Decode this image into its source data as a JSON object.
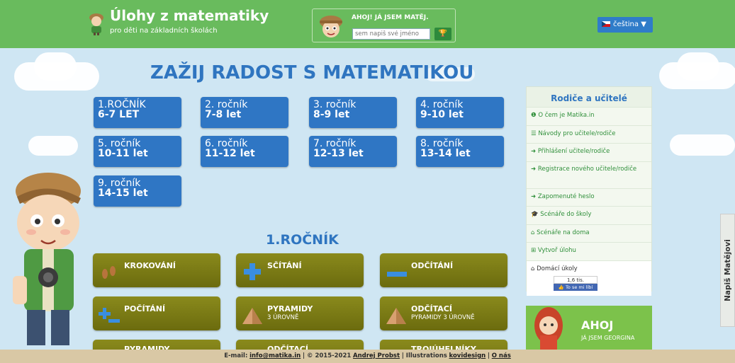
{
  "header": {
    "title": "Úlohy z matematiky",
    "subtitle": "pro děti na základních školách",
    "greeting": "AHOJ! JÁ JSEM MATĚJ.",
    "name_placeholder": "sem napiš své jméno",
    "language": "čeština",
    "colors": {
      "bar": "#69bb5d",
      "language_button": "#2f7cc9"
    }
  },
  "main": {
    "title": "ZAŽIJ RADOST S MATEMATIKOU",
    "grades": [
      {
        "label": "1.ROČNÍK",
        "ages": "6-7 LET"
      },
      {
        "label": "2. ročník",
        "ages": "7-8 let"
      },
      {
        "label": "3. ročník",
        "ages": "8-9 let"
      },
      {
        "label": "4. ročník",
        "ages": "9-10 let"
      },
      {
        "label": "5. ročník",
        "ages": "10-11 let"
      },
      {
        "label": "6. ročník",
        "ages": "11-12 let"
      },
      {
        "label": "7. ročník",
        "ages": "12-13 let"
      },
      {
        "label": "8. ročník",
        "ages": "13-14 let"
      },
      {
        "label": "9. ročník",
        "ages": "14-15 let"
      }
    ],
    "section_title": "1.ROČNÍK",
    "topics": [
      {
        "name": "KROKOVÁNÍ",
        "sub": "",
        "icon": "footprints-icon"
      },
      {
        "name": "SČÍTÁNÍ",
        "sub": "",
        "icon": "plus-icon"
      },
      {
        "name": "ODČÍTÁNÍ",
        "sub": "",
        "icon": "minus-icon"
      },
      {
        "name": "POČÍTÁNÍ",
        "sub": "",
        "icon": "plus-minus-icon"
      },
      {
        "name": "PYRAMIDY",
        "sub": "3 ÚROVNĚ",
        "icon": "pyramid-icon"
      },
      {
        "name": "ODČÍTACÍ",
        "sub": "PYRAMIDY 3 ÚROVNĚ",
        "icon": "pyramid-icon"
      },
      {
        "name": "PYRAMIDY",
        "sub": "",
        "icon": "pyramid-icon"
      },
      {
        "name": "ODČÍTACÍ",
        "sub": "",
        "icon": "pyramid-icon"
      },
      {
        "name": "TROJÚHELNÍKY",
        "sub": "",
        "icon": "triangle-icon"
      }
    ],
    "colors": {
      "grade_button": "#2f76c4",
      "topic_button": "#7a7a14"
    }
  },
  "sidebar": {
    "title": "Rodiče a učitelé",
    "items": [
      {
        "icon": "info-icon",
        "glyph": "❶",
        "label": "O čem je Matika.in"
      },
      {
        "icon": "list-icon",
        "glyph": "☰",
        "label": "Návody pro učitele/rodiče"
      },
      {
        "icon": "login-icon",
        "glyph": "➜",
        "label": "Přihlášení učitele/rodiče"
      },
      {
        "icon": "login-icon",
        "glyph": "➜",
        "label": "Registrace nového učitele/rodiče"
      },
      {
        "icon": "login-icon",
        "glyph": "➜",
        "label": "Zapomenuté heslo"
      },
      {
        "icon": "graduation-cap-icon",
        "glyph": "🎓",
        "label": "Scénáře do školy"
      },
      {
        "icon": "home-icon",
        "glyph": "⌂",
        "label": "Scénáře na doma"
      },
      {
        "icon": "plus-square-icon",
        "glyph": "⊞",
        "label": "Vytvoř úlohu"
      },
      {
        "icon": "home-icon",
        "glyph": "⌂",
        "label": "Domácí úkoly"
      }
    ],
    "like_count": "1,6 tis.",
    "like_label": "To se mi líbí"
  },
  "promo": {
    "hello": "AHOJ",
    "sub": "JÁ JSEM GEORGINA"
  },
  "side_tab": "Napiš Matějovi",
  "footer": {
    "email_label": "E-mail:",
    "email": "info@matika.in",
    "copyright": "| © 2015-2021",
    "author": "Andrej Probst",
    "illustrations": "| Illustrations",
    "illustrator": "kovidesign",
    "sep": "|",
    "about": "O nás"
  }
}
